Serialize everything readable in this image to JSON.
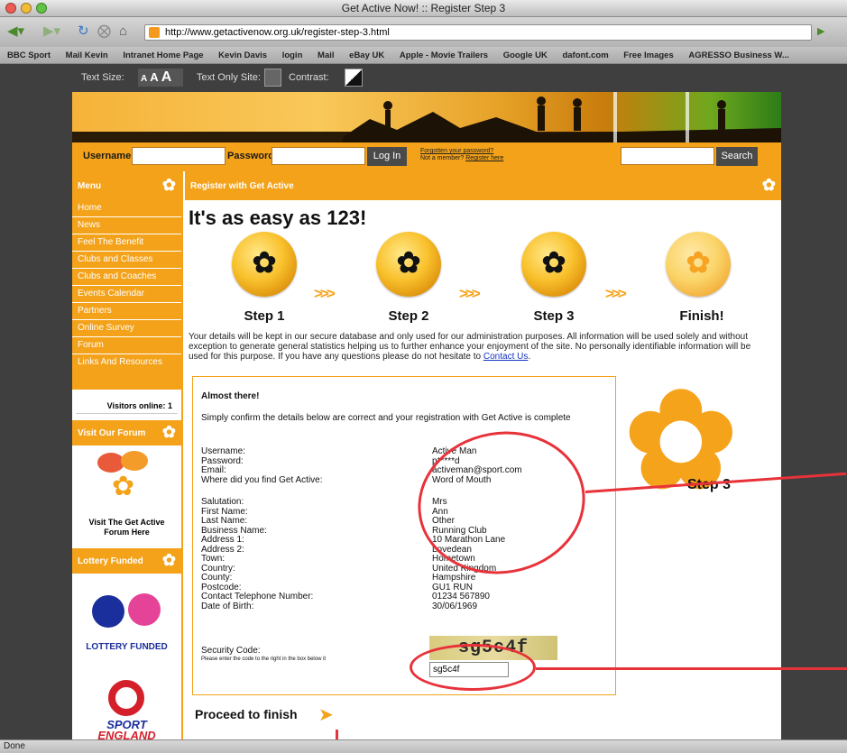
{
  "browser": {
    "window_title": "Get Active Now! :: Register Step 3",
    "url": "http://www.getactivenow.org.uk/register-step-3.html",
    "status": "Done",
    "bookmarks": [
      "BBC Sport",
      "Mail Kevin",
      "Intranet Home Page",
      "Kevin Davis",
      "login",
      "Mail",
      "eBay UK",
      "Apple - Movie Trailers",
      "Google UK",
      "dafont.com",
      "Free Images",
      "AGRESSO Business W..."
    ]
  },
  "accessibility": {
    "text_size_label": "Text Size:",
    "text_size_options": [
      "A",
      "A",
      "A"
    ],
    "text_only_label": "Text Only Site:",
    "contrast_label": "Contrast:"
  },
  "login": {
    "username_label": "Username",
    "password_label": "Password",
    "login_button": "Log In",
    "forgotten_link": "Forgotten your password?",
    "not_member_text": "Not a member?",
    "register_link": "Register here",
    "search_button": "Search"
  },
  "sidebar": {
    "menu_header": "Menu",
    "items": [
      "Home",
      "News",
      "Feel The Benefit",
      "Clubs and Classes",
      "Clubs and Coaches",
      "Events Calendar",
      "Partners",
      "Online Survey",
      "Forum",
      "Links And Resources"
    ],
    "visitors_online": "Visitors online: 1",
    "forum_header": "Visit Our Forum",
    "forum_caption": "Visit The Get Active Forum Here",
    "lottery_header": "Lottery Funded",
    "lottery_caption": "LOTTERY FUNDED",
    "sport_england_caption_1": "SPORT",
    "sport_england_caption_2": "ENGLAND"
  },
  "main": {
    "header": "Register with Get Active",
    "heading": "It's as easy as 123!",
    "steps": [
      "Step 1",
      "Step 2",
      "Step 3",
      "Finish!"
    ],
    "arrows": ">>>",
    "privacy_text": "Your details will be kept in our secure database and only used for our administration purposes. All information will be used solely and without exception to generate general statistics helping us to further enhance your enjoyment of the site. No personally identifiable information will be used for this purpose. If you have any questions please do not hesitate to",
    "contact_link": "Contact Us",
    "side_step_label": "Step 3",
    "proceed": "Proceed to finish"
  },
  "form": {
    "heading": "Almost there!",
    "intro": "Simply confirm the details below are correct and your registration with Get Active is complete",
    "group1": [
      {
        "label": "Username:",
        "value": "Active Man"
      },
      {
        "label": "Password:",
        "value": "p*****d"
      },
      {
        "label": "Email:",
        "value": "activeman@sport.com"
      },
      {
        "label": "Where did you find Get Active:",
        "value": "Word of Mouth"
      }
    ],
    "group2": [
      {
        "label": "Salutation:",
        "value": "Mrs"
      },
      {
        "label": "First Name:",
        "value": "Ann"
      },
      {
        "label": "Last Name:",
        "value": "Other"
      },
      {
        "label": "Business Name:",
        "value": "Running Club"
      },
      {
        "label": "Address 1:",
        "value": "10 Marathon Lane"
      },
      {
        "label": "Address 2:",
        "value": "Lovedean"
      },
      {
        "label": "Town:",
        "value": "Hometown"
      },
      {
        "label": "Country:",
        "value": "United Kingdom"
      },
      {
        "label": "County:",
        "value": "Hampshire"
      },
      {
        "label": "Postcode:",
        "value": "GU1 RUN"
      },
      {
        "label": "Contact Telephone Number:",
        "value": "01234 567890"
      },
      {
        "label": "Date of Birth:",
        "value": "30/06/1969"
      }
    ],
    "security_label": "Security Code:",
    "security_hint": "Please enter the code to the right in the box below it",
    "captcha": "sg5c4f",
    "security_input_value": "sg5c4f"
  },
  "colors": {
    "brand_orange": "#f3a21a",
    "annotation_red": "#e8323a"
  }
}
